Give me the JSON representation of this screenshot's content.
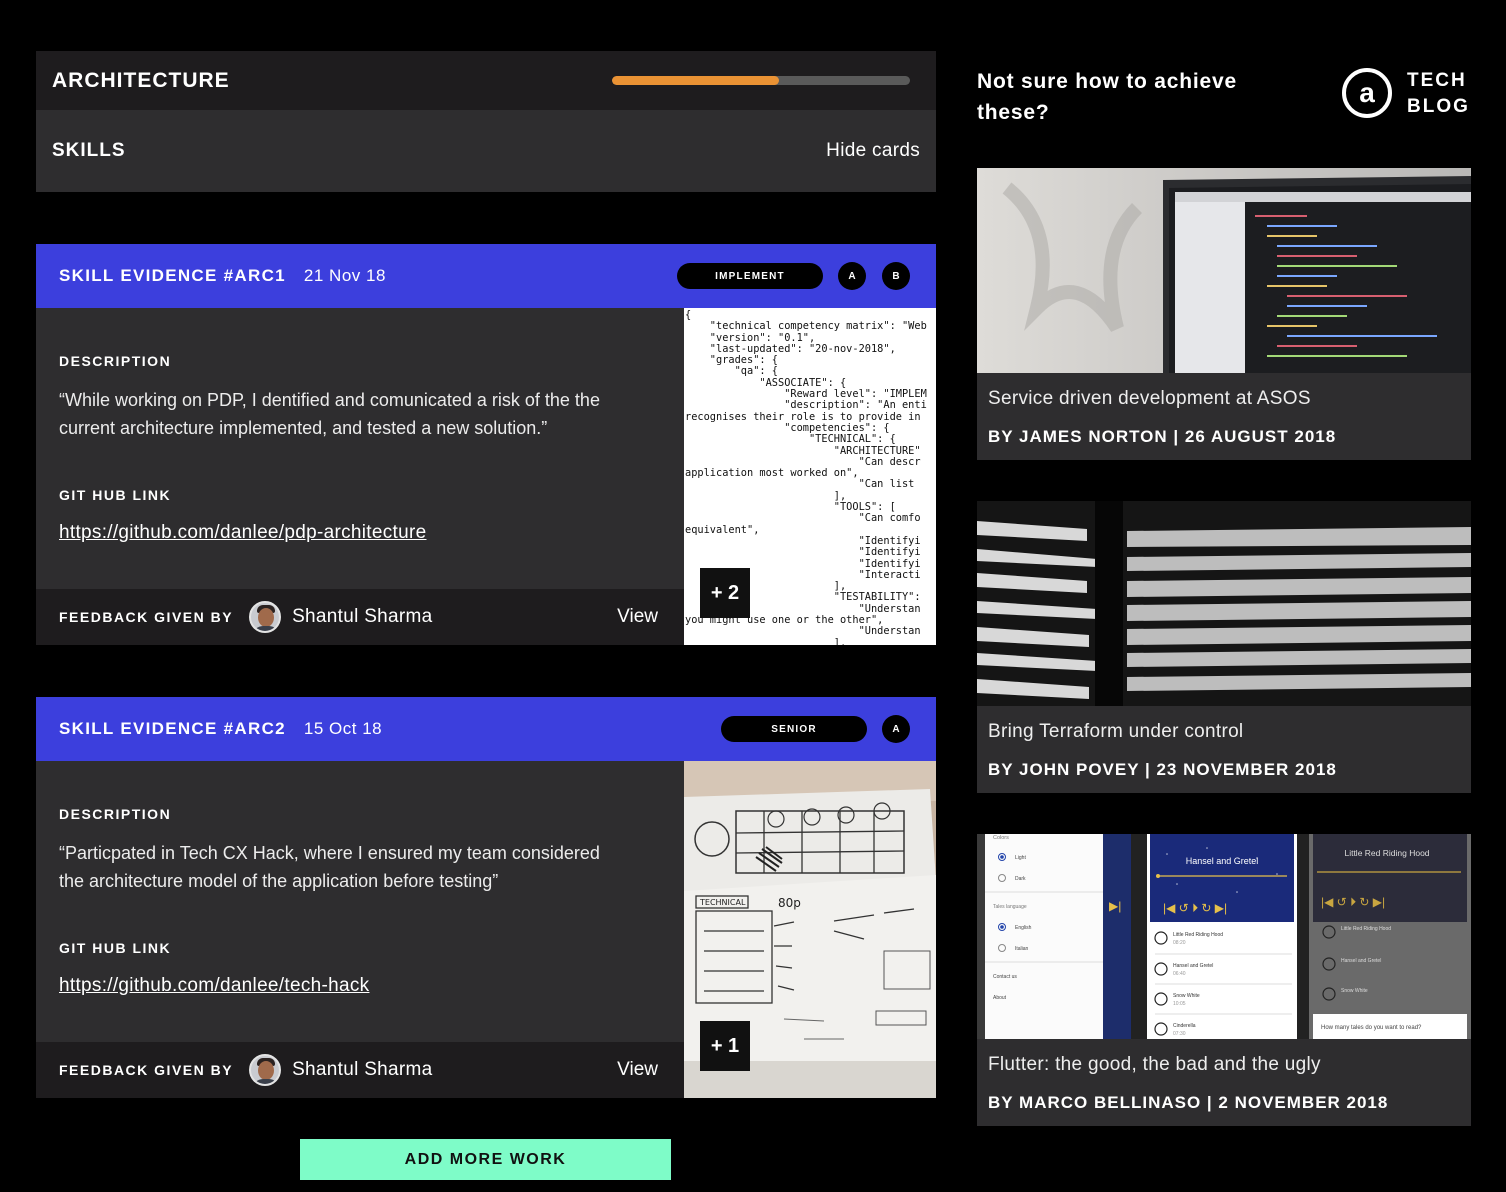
{
  "section": {
    "title": "ARCHITECTURE",
    "progress_percent": 56,
    "progress_color": "#ea9234"
  },
  "skills": {
    "title": "SKILLS",
    "toggle_label": "Hide cards"
  },
  "cards": [
    {
      "title": "SKILL EVIDENCE #ARC1",
      "date": "21 Nov 18",
      "level": "IMPLEMENT",
      "grades": [
        "A",
        "B"
      ],
      "description_label": "DESCRIPTION",
      "description": "“While working on PDP, I dentified and comunicated a risk of the the current architecture implemented, and tested a new solution.”",
      "link_label": "GIT HUB LINK",
      "link": "https://github.com/danlee/pdp-architecture",
      "feedback_label": "FEEDBACK GIVEN BY",
      "feedback_name": "Shantul Sharma",
      "view_label": "View",
      "more_count": "+ 2"
    },
    {
      "title": "SKILL EVIDENCE #ARC2",
      "date": "15 Oct 18",
      "level": "SENIOR",
      "grades": [
        "A"
      ],
      "description_label": "DESCRIPTION",
      "description": "“Particpated in Tech CX Hack, where I ensured my team considered the architecture model of the application before testing”",
      "link_label": "GIT HUB LINK",
      "link": "https://github.com/danlee/tech-hack",
      "feedback_label": "FEEDBACK GIVEN BY",
      "feedback_name": "Shantul Sharma",
      "view_label": "View",
      "more_count": "+ 1"
    }
  ],
  "code_snippet": "{\n    \"technical competency matrix\": \"Web\n    \"version\": \"0.1\",\n    \"last-updated\": \"20-nov-2018\",\n    \"grades\": {\n        \"qa\": {\n            \"ASSOCIATE\": {\n                \"Reward level\": \"IMPLEM\n                \"description\": \"An enti\nrecognises their role is to provide in\n                \"competencies\": {\n                    \"TECHNICAL\": {\n                        \"ARCHITECTURE\"\n                            \"Can descr\napplication most worked on\",\n                            \"Can list \n                        ],\n                        \"TOOLS\": [\n                            \"Can comfo\nequivalent\",\n                            \"Identifyi\n                            \"Identifyi\n                            \"Identifyi\n                            \"Interacti\n                        ],\n                        \"TESTABILITY\":\n                            \"Understan\nyou might use one or the other\",\n                            \"Understan\n                        ],",
  "add_button": "ADD MORE WORK",
  "blog": {
    "heading": "Not sure how to achieve these?",
    "logo_symbol": "a",
    "logo_line1": "TECH",
    "logo_line2": "BLOG",
    "posts": [
      {
        "title": "Service driven development at ASOS",
        "meta": "BY JAMES NORTON | 26 AUGUST 2018"
      },
      {
        "title": "Bring Terraform under control",
        "meta": "BY JOHN POVEY | 23 NOVEMBER 2018"
      },
      {
        "title": "Flutter: the good, the bad and the ugly",
        "meta": "BY MARCO BELLINASO | 2 NOVEMBER 2018"
      }
    ]
  },
  "flutter_mock": {
    "colors_label": "Colors",
    "light": "Light",
    "dark": "Dark",
    "tales_language": "Tales language",
    "english": "English",
    "italian": "Italian",
    "contact": "Contact us",
    "about": "About",
    "screen2_title": "Hansel and Gretel",
    "screen3_title": "Little Red Riding Hood",
    "list": [
      "Little Red Riding Hood",
      "Hansel and Gretel",
      "Snow White",
      "Cinderella"
    ],
    "list_times": [
      "08:20",
      "06:40",
      "10:05",
      "07:30"
    ],
    "question": "How many tales do you want to read?"
  },
  "sketch": {
    "label": "TECHNICAL",
    "note": "80p"
  }
}
